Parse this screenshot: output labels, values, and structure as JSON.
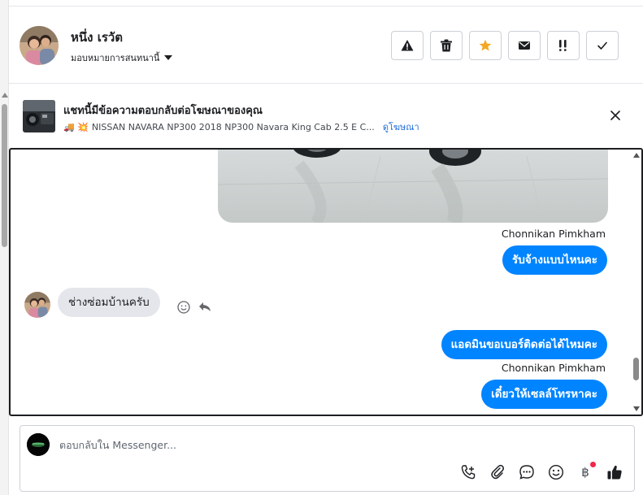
{
  "header": {
    "user_name": "หนึ่ง เรวัต",
    "assign_label": "มอบหมายการสนทนานี้",
    "actions": [
      {
        "name": "report-spam-button",
        "icon": "warning-icon"
      },
      {
        "name": "delete-button",
        "icon": "trash-icon"
      },
      {
        "name": "star-button",
        "icon": "star-icon"
      },
      {
        "name": "mark-unread-button",
        "icon": "envelope-icon"
      },
      {
        "name": "follow-up-button",
        "icon": "flag-important-icon"
      },
      {
        "name": "mark-done-button",
        "icon": "checkmark-icon"
      }
    ],
    "star_color": "#f5a623"
  },
  "ad_banner": {
    "title": "แชทนี้มีข้อความตอบกลับต่อโฆษณาของคุณ",
    "emoji_text": "🚚 💥",
    "ad_text": "NISSAN NAVARA NP300 2018 NP300 Navara King Cab 2.5 E C...",
    "link": "ดูโฆษณา"
  },
  "messages": {
    "sender1": "Chonnikan Pimkham",
    "out1": "รับจ้างแบบไหนคะ",
    "in1": "ช่างซ่อมบ้านครับ",
    "out2": "แอดมินขอเบอร์ติดต่อได้ไหมคะ",
    "sender2": "Chonnikan Pimkham",
    "out3": "เดี๋ยวให้เซลล์โทรหาคะ"
  },
  "composer": {
    "placeholder": "ตอบกลับใน Messenger...",
    "baht_symbol": "฿"
  },
  "colors": {
    "accent": "#0084ff",
    "incoming_bubble": "#e4e6eb",
    "notification_dot": "#f02849",
    "link": "#216fdb"
  }
}
